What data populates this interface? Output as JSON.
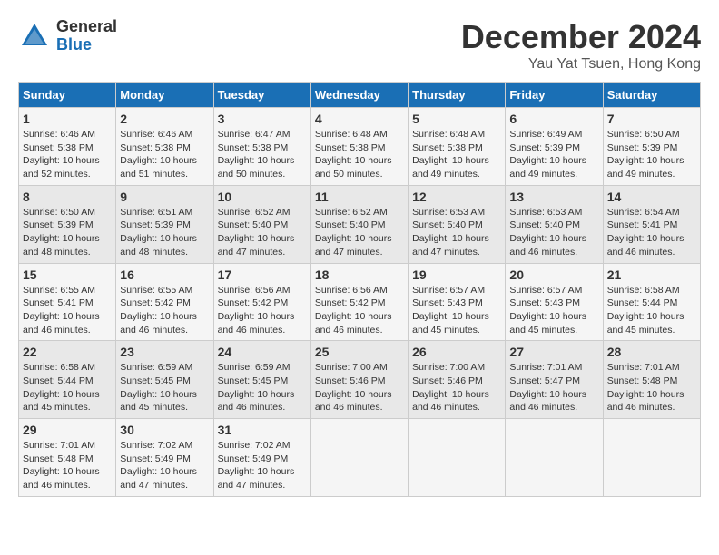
{
  "header": {
    "logo_general": "General",
    "logo_blue": "Blue",
    "month_title": "December 2024",
    "location": "Yau Yat Tsuen, Hong Kong"
  },
  "calendar": {
    "days_of_week": [
      "Sunday",
      "Monday",
      "Tuesday",
      "Wednesday",
      "Thursday",
      "Friday",
      "Saturday"
    ],
    "weeks": [
      [
        {
          "day": "",
          "info": ""
        },
        {
          "day": "2",
          "info": "Sunrise: 6:46 AM\nSunset: 5:38 PM\nDaylight: 10 hours\nand 51 minutes."
        },
        {
          "day": "3",
          "info": "Sunrise: 6:47 AM\nSunset: 5:38 PM\nDaylight: 10 hours\nand 50 minutes."
        },
        {
          "day": "4",
          "info": "Sunrise: 6:48 AM\nSunset: 5:38 PM\nDaylight: 10 hours\nand 50 minutes."
        },
        {
          "day": "5",
          "info": "Sunrise: 6:48 AM\nSunset: 5:38 PM\nDaylight: 10 hours\nand 49 minutes."
        },
        {
          "day": "6",
          "info": "Sunrise: 6:49 AM\nSunset: 5:39 PM\nDaylight: 10 hours\nand 49 minutes."
        },
        {
          "day": "7",
          "info": "Sunrise: 6:50 AM\nSunset: 5:39 PM\nDaylight: 10 hours\nand 49 minutes."
        }
      ],
      [
        {
          "day": "1",
          "info": "Sunrise: 6:46 AM\nSunset: 5:38 PM\nDaylight: 10 hours\nand 52 minutes."
        },
        {
          "day": "8",
          "info": "Sunrise: 6:50 AM\nSunset: 5:39 PM\nDaylight: 10 hours\nand 48 minutes."
        },
        {
          "day": "9",
          "info": "Sunrise: 6:51 AM\nSunset: 5:39 PM\nDaylight: 10 hours\nand 48 minutes."
        },
        {
          "day": "10",
          "info": "Sunrise: 6:52 AM\nSunset: 5:40 PM\nDaylight: 10 hours\nand 47 minutes."
        },
        {
          "day": "11",
          "info": "Sunrise: 6:52 AM\nSunset: 5:40 PM\nDaylight: 10 hours\nand 47 minutes."
        },
        {
          "day": "12",
          "info": "Sunrise: 6:53 AM\nSunset: 5:40 PM\nDaylight: 10 hours\nand 47 minutes."
        },
        {
          "day": "13",
          "info": "Sunrise: 6:53 AM\nSunset: 5:40 PM\nDaylight: 10 hours\nand 46 minutes."
        },
        {
          "day": "14",
          "info": "Sunrise: 6:54 AM\nSunset: 5:41 PM\nDaylight: 10 hours\nand 46 minutes."
        }
      ],
      [
        {
          "day": "15",
          "info": "Sunrise: 6:55 AM\nSunset: 5:41 PM\nDaylight: 10 hours\nand 46 minutes."
        },
        {
          "day": "16",
          "info": "Sunrise: 6:55 AM\nSunset: 5:42 PM\nDaylight: 10 hours\nand 46 minutes."
        },
        {
          "day": "17",
          "info": "Sunrise: 6:56 AM\nSunset: 5:42 PM\nDaylight: 10 hours\nand 46 minutes."
        },
        {
          "day": "18",
          "info": "Sunrise: 6:56 AM\nSunset: 5:42 PM\nDaylight: 10 hours\nand 46 minutes."
        },
        {
          "day": "19",
          "info": "Sunrise: 6:57 AM\nSunset: 5:43 PM\nDaylight: 10 hours\nand 45 minutes."
        },
        {
          "day": "20",
          "info": "Sunrise: 6:57 AM\nSunset: 5:43 PM\nDaylight: 10 hours\nand 45 minutes."
        },
        {
          "day": "21",
          "info": "Sunrise: 6:58 AM\nSunset: 5:44 PM\nDaylight: 10 hours\nand 45 minutes."
        }
      ],
      [
        {
          "day": "22",
          "info": "Sunrise: 6:58 AM\nSunset: 5:44 PM\nDaylight: 10 hours\nand 45 minutes."
        },
        {
          "day": "23",
          "info": "Sunrise: 6:59 AM\nSunset: 5:45 PM\nDaylight: 10 hours\nand 45 minutes."
        },
        {
          "day": "24",
          "info": "Sunrise: 6:59 AM\nSunset: 5:45 PM\nDaylight: 10 hours\nand 46 minutes."
        },
        {
          "day": "25",
          "info": "Sunrise: 7:00 AM\nSunset: 5:46 PM\nDaylight: 10 hours\nand 46 minutes."
        },
        {
          "day": "26",
          "info": "Sunrise: 7:00 AM\nSunset: 5:46 PM\nDaylight: 10 hours\nand 46 minutes."
        },
        {
          "day": "27",
          "info": "Sunrise: 7:01 AM\nSunset: 5:47 PM\nDaylight: 10 hours\nand 46 minutes."
        },
        {
          "day": "28",
          "info": "Sunrise: 7:01 AM\nSunset: 5:48 PM\nDaylight: 10 hours\nand 46 minutes."
        }
      ],
      [
        {
          "day": "29",
          "info": "Sunrise: 7:01 AM\nSunset: 5:48 PM\nDaylight: 10 hours\nand 46 minutes."
        },
        {
          "day": "30",
          "info": "Sunrise: 7:02 AM\nSunset: 5:49 PM\nDaylight: 10 hours\nand 47 minutes."
        },
        {
          "day": "31",
          "info": "Sunrise: 7:02 AM\nSunset: 5:49 PM\nDaylight: 10 hours\nand 47 minutes."
        },
        {
          "day": "",
          "info": ""
        },
        {
          "day": "",
          "info": ""
        },
        {
          "day": "",
          "info": ""
        },
        {
          "day": "",
          "info": ""
        }
      ]
    ]
  }
}
